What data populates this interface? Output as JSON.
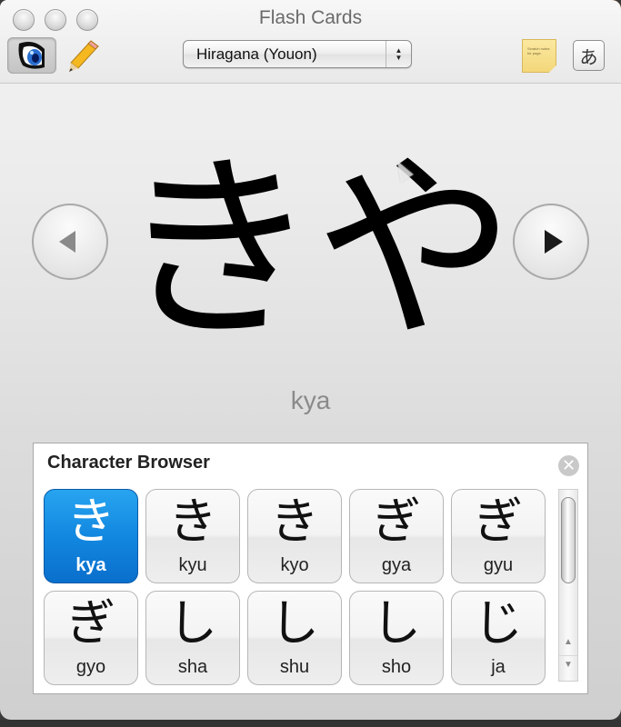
{
  "window": {
    "title": "Flash Cards"
  },
  "toolbar": {
    "view_mode_icon": "eye-icon",
    "edit_mode_icon": "pencil-icon",
    "deck_select": {
      "selected": "Hiragana (Youon)",
      "arrow_up": "▲",
      "arrow_down": "▼"
    },
    "notes_button": {
      "icon": "sticky-note-icon",
      "text": "Scratch notes for page."
    },
    "kana_button": {
      "label": "あ"
    }
  },
  "card": {
    "character": "きや",
    "romaji": "kya",
    "prev_button": {
      "icon": "arrow-left-icon",
      "glyph": "◀",
      "enabled": false
    },
    "next_button": {
      "icon": "arrow-right-icon",
      "glyph": "▶",
      "enabled": true
    }
  },
  "character_browser": {
    "title": "Character Browser",
    "close_glyph": "✕",
    "selected_index": 0,
    "tiles": [
      {
        "kana": "き",
        "romaji": "kya"
      },
      {
        "kana": "き",
        "romaji": "kyu"
      },
      {
        "kana": "き",
        "romaji": "kyo"
      },
      {
        "kana": "ぎ",
        "romaji": "gya"
      },
      {
        "kana": "ぎ",
        "romaji": "gyu"
      },
      {
        "kana": "ぎ",
        "romaji": "gyo"
      },
      {
        "kana": "し",
        "romaji": "sha"
      },
      {
        "kana": "し",
        "romaji": "shu"
      },
      {
        "kana": "し",
        "romaji": "sho"
      },
      {
        "kana": "じ",
        "romaji": "ja"
      }
    ],
    "scrollbar": {
      "up_glyph": "▲",
      "down_glyph": "▼"
    }
  }
}
